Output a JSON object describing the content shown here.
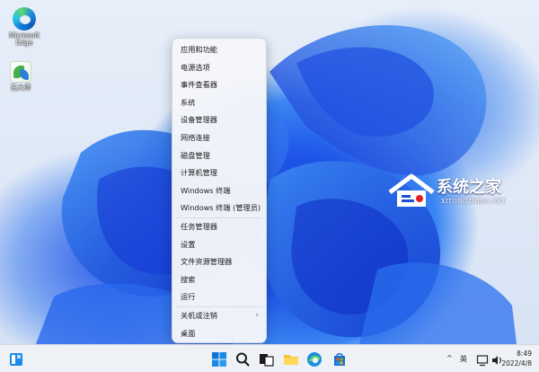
{
  "desktop": {
    "icons": [
      {
        "label_line1": "Microsoft",
        "label_line2": "Edge",
        "icon": "edge-icon"
      },
      {
        "label_line1": "石大师",
        "label_line2": "",
        "icon": "app-icon"
      }
    ]
  },
  "context_menu": {
    "items": [
      "应用和功能",
      "电源选项",
      "事件查看器",
      "系统",
      "设备管理器",
      "网络连接",
      "磁盘管理",
      "计算机管理",
      "Windows 终端",
      "Windows 终端 (管理员)",
      "任务管理器",
      "设置",
      "文件资源管理器",
      "搜索",
      "运行",
      "关机或注销",
      "桌面"
    ],
    "submenu_indicator": "›"
  },
  "watermark": {
    "title": "系统之家",
    "subtitle": "XITONGZHIJIA.NET"
  },
  "taskbar": {
    "tray": {
      "chevron": "^",
      "language": "英",
      "time": "8:49",
      "date": "2022/4/8"
    }
  },
  "colors": {
    "accent": "#0067c0",
    "arrow": "#e02020",
    "menu_bg": "#f5f6fa"
  }
}
